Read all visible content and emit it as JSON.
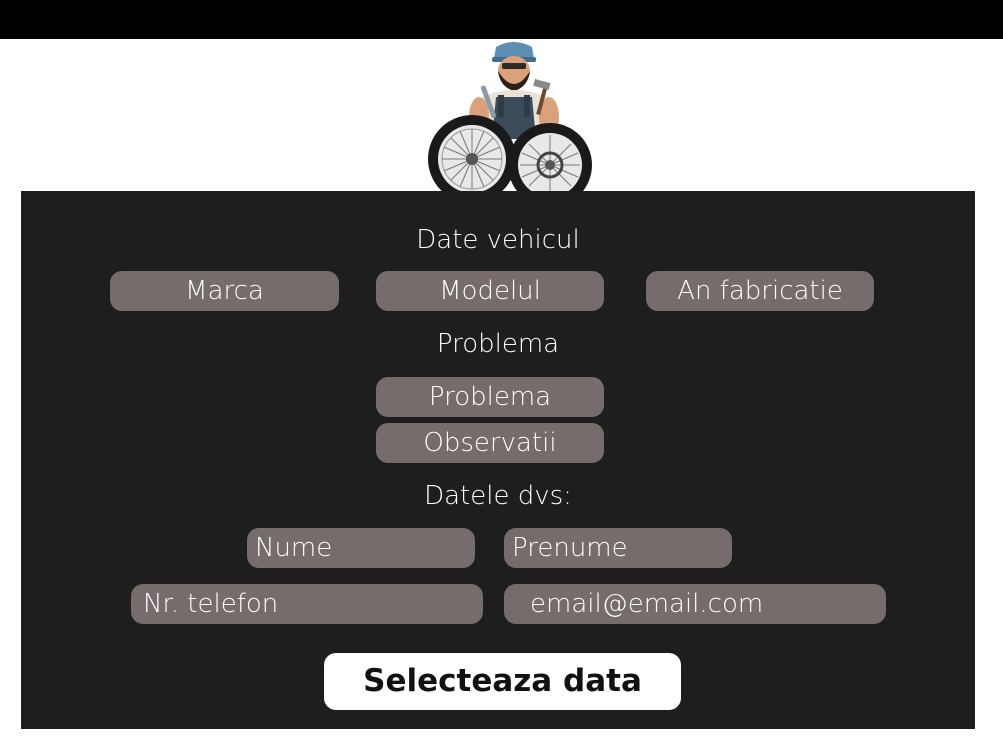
{
  "form": {
    "vehicle_heading": "Date vehicul",
    "brand_placeholder": "Marca",
    "model_placeholder": "Modelul",
    "year_placeholder": "An fabricatie",
    "problem_heading": "Problema",
    "problem_placeholder": "Problema",
    "notes_placeholder": "Observatii",
    "personal_heading": "Datele dvs:",
    "lastname_placeholder": "Nume",
    "firstname_placeholder": "Prenume",
    "phone_placeholder": "Nr. telefon",
    "email_placeholder": "email@email.com",
    "submit_label": "Selecteaza data"
  },
  "logo": {
    "icon": "mechanic-with-tires-logo"
  },
  "colors": {
    "panel": "#1e1e1e",
    "field": "#766c6c",
    "topbar": "#000000",
    "button": "#ffffff"
  }
}
